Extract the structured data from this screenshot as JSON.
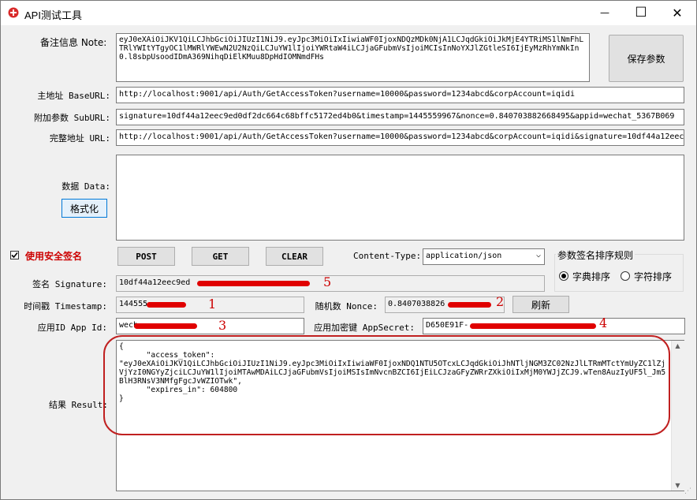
{
  "window": {
    "title": "API测试工具",
    "minimize": "—",
    "maximize": "☐",
    "close": "✕"
  },
  "note": {
    "label": "备注信息 Note:",
    "value": "eyJ0eXAiOiJKV1QiLCJhbGciOiJIUzI1NiJ9.eyJpc3MiOiIxIiwiaWF0IjoxNDQzMDk0NjA1LCJqdGkiOiJkMjE4YTRiMS1lNmFhLTRlYWItYTgyOC1lMWRlYWEwN2U2NzQiLCJuYW1lIjoiYWRtaW4iLCJjaGFubmVsIjoiMCIsInNoYXJlZGtleSI6IjEyMzRhYmNkIn0.l8sbpUsoodIDmA369NihqDiElKMuu8DpHdIOMNmdFHs"
  },
  "save_button": "保存参数",
  "base_url": {
    "label": "主地址 BaseURL:",
    "value": "http://localhost:9001/api/Auth/GetAccessToken?username=10000&password=1234abcd&corpAccount=iqidi"
  },
  "sub_url": {
    "label": "附加参数 SubURL:",
    "value": "signature=10df44a12eec9ed0df2dc664c68bffc5172ed4b0&timestamp=1445559967&nonce=0.840703882668495&appid=wechat_5367B069"
  },
  "full_url": {
    "label": "完整地址 URL:",
    "value": "http://localhost:9001/api/Auth/GetAccessToken?username=10000&password=1234abcd&corpAccount=iqidi&signature=10df44a12eec9"
  },
  "data": {
    "label": "数据 Data:",
    "format_button": "格式化",
    "value": ""
  },
  "secure_sign": {
    "label": "使用安全签名",
    "checked": true
  },
  "buttons": {
    "post": "POST",
    "get": "GET",
    "clear": "CLEAR"
  },
  "content_type": {
    "label": "Content-Type:",
    "value": "application/json"
  },
  "sort_group": {
    "title": "参数签名排序规则",
    "options": [
      "字典排序",
      "字符排序"
    ],
    "selected": "字典排序"
  },
  "signature": {
    "label": "签名 Signature:",
    "value": "10df44a12eec9ed"
  },
  "timestamp": {
    "label": "时间戳 Timestamp:",
    "value": "144555"
  },
  "nonce": {
    "label": "随机数 Nonce:",
    "value": "0.8407038826",
    "refresh_button": "刷新"
  },
  "app_id": {
    "label": "应用ID App Id:",
    "value": "wech"
  },
  "app_secret": {
    "label": "应用加密键 AppSecret:",
    "value": "D650E91F-"
  },
  "result": {
    "label": "结果 Result:",
    "value": "{\n      \"access_token\":\n\"eyJ0eXAiOiJKV1QiLCJhbGciOiJIUzI1NiJ9.eyJpc3MiOiIxIiwiaWF0IjoxNDQ1NTU5OTcxLCJqdGkiOiJhNTljNGM3ZC02NzJlLTRmMTctYmUyZC1lZjVjYzI0NGYyZjciLCJuYW1lIjoiMTAwMDAiLCJjaGFubmVsIjoiMSIsImNvcnBZCI6IjEiLCJzaGFyZWRrZXkiOiIxMjM0YWJjZCJ9.wTen8AuzIyUF5l_Jm5BlH3RNsV3NMfgFgcJvWZIOTwk\",\n      \"expires_in\": 604800\n}"
  },
  "annotations": [
    "1",
    "2",
    "3",
    "4",
    "5"
  ],
  "colors": {
    "annotation_red": "#e00000",
    "secure_label_red": "#cc0000"
  }
}
